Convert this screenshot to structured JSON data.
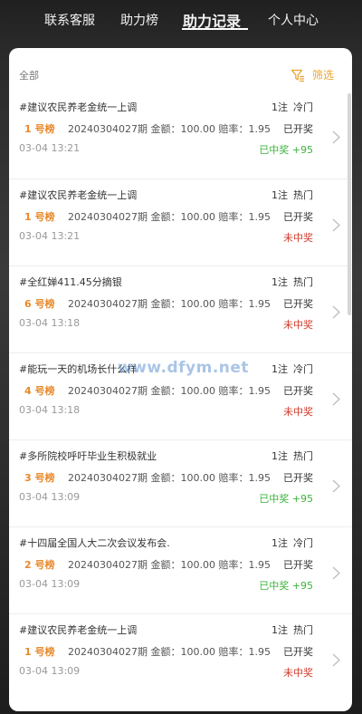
{
  "nav": {
    "tabs": [
      "联系客服",
      "助力榜",
      "助力记录",
      "个人中心"
    ],
    "active_index": 2
  },
  "filter": {
    "all_label": "全部",
    "filter_label": "筛选",
    "filter_icon": "funnel-icon"
  },
  "records": [
    {
      "title": "#建议农民养老金统一上调",
      "bets": "1注",
      "tag": "冷门",
      "board": "1 号榜",
      "issue": "20240304027期",
      "amount": "金额：100.00",
      "odds": "赔率：1.95",
      "status": "已开奖",
      "time": "03-04 13:21",
      "result": "已中奖 +95",
      "win": true
    },
    {
      "title": "#建议农民养老金统一上调",
      "bets": "1注",
      "tag": "热门",
      "board": "1 号榜",
      "issue": "20240304027期",
      "amount": "金额：100.00",
      "odds": "赔率：1.95",
      "status": "已开奖",
      "time": "03-04 13:21",
      "result": "未中奖",
      "win": false
    },
    {
      "title": "#全红婵411.45分摘银",
      "bets": "1注",
      "tag": "热门",
      "board": "6 号榜",
      "issue": "20240304027期",
      "amount": "金额：100.00",
      "odds": "赔率：1.95",
      "status": "已开奖",
      "time": "03-04 13:18",
      "result": "未中奖",
      "win": false
    },
    {
      "title": "#能玩一天的机场长什么样",
      "bets": "1注",
      "tag": "冷门",
      "board": "4 号榜",
      "issue": "20240304027期",
      "amount": "金额：100.00",
      "odds": "赔率：1.95",
      "status": "已开奖",
      "time": "03-04 13:18",
      "result": "未中奖",
      "win": false
    },
    {
      "title": "#多所院校呼吁毕业生积极就业",
      "bets": "1注",
      "tag": "热门",
      "board": "3 号榜",
      "issue": "20240304027期",
      "amount": "金额：100.00",
      "odds": "赔率：1.95",
      "status": "已开奖",
      "time": "03-04 13:09",
      "result": "已中奖 +95",
      "win": true
    },
    {
      "title": "#十四届全国人大二次会议发布会.",
      "bets": "1注",
      "tag": "冷门",
      "board": "2 号榜",
      "issue": "20240304027期",
      "amount": "金额：100.00",
      "odds": "赔率：1.95",
      "status": "已开奖",
      "time": "03-04 13:09",
      "result": "已中奖 +95",
      "win": true
    },
    {
      "title": "#建议农民养老金统一上调",
      "bets": "1注",
      "tag": "热门",
      "board": "1 号榜",
      "issue": "20240304027期",
      "amount": "金额：100.00",
      "odds": "赔率：1.95",
      "status": "已开奖",
      "time": "03-04 13:09",
      "result": "未中奖",
      "win": false
    }
  ],
  "watermark": "www.dfym.net",
  "colors": {
    "accent": "#e8a531",
    "board": "#e8892a",
    "win": "#3bb33b",
    "lose": "#d23a2a"
  }
}
